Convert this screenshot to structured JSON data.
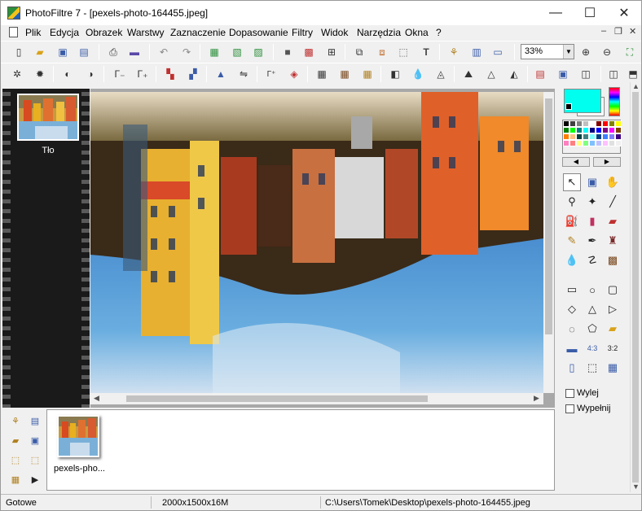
{
  "window": {
    "title": "PhotoFiltre 7 - [pexels-photo-164455.jpeg]",
    "minimize": "—",
    "maximize": "☐",
    "close": "✕"
  },
  "menu": [
    "Plik",
    "Edycja",
    "Obrazek",
    "Warstwy",
    "Zaznaczenie",
    "Dopasowanie",
    "Filtry",
    "Widok",
    "Narzędzia",
    "Okna",
    "?"
  ],
  "mdi": {
    "minimize": "–",
    "restore": "❐",
    "close": "✕"
  },
  "toolbar": {
    "zoom": "33%"
  },
  "layers": {
    "name": "Tło"
  },
  "options": {
    "feather_label": "Wylej",
    "fill_label": "Wypełnij"
  },
  "explorer": {
    "doc_name": "pexels-pho..."
  },
  "status": {
    "state": "Gotowe",
    "dimensions": "2000x1500x16M",
    "path": "C:\\Users\\Tomek\\Desktop\\pexels-photo-164455.jpeg"
  },
  "colors": {
    "foreground": "#00ffee",
    "background": "#ffffff",
    "palette": [
      "#000000",
      "#404040",
      "#808080",
      "#c0c0c0",
      "#ffffff",
      "#800000",
      "#ff0000",
      "#808000",
      "#ffff00",
      "#008000",
      "#00ff00",
      "#008080",
      "#00ffff",
      "#000080",
      "#0000ff",
      "#800080",
      "#ff00ff",
      "#804000",
      "#ff8000",
      "#ffc080",
      "#004040",
      "#408080",
      "#80ffff",
      "#004080",
      "#4080ff",
      "#8080ff",
      "#400080",
      "#ff80c0",
      "#ff8080",
      "#ffff80",
      "#80ff80",
      "#80c0ff",
      "#c0c0ff",
      "#ffc0ff",
      "#e0e0e0",
      "#f0f0f0"
    ]
  }
}
